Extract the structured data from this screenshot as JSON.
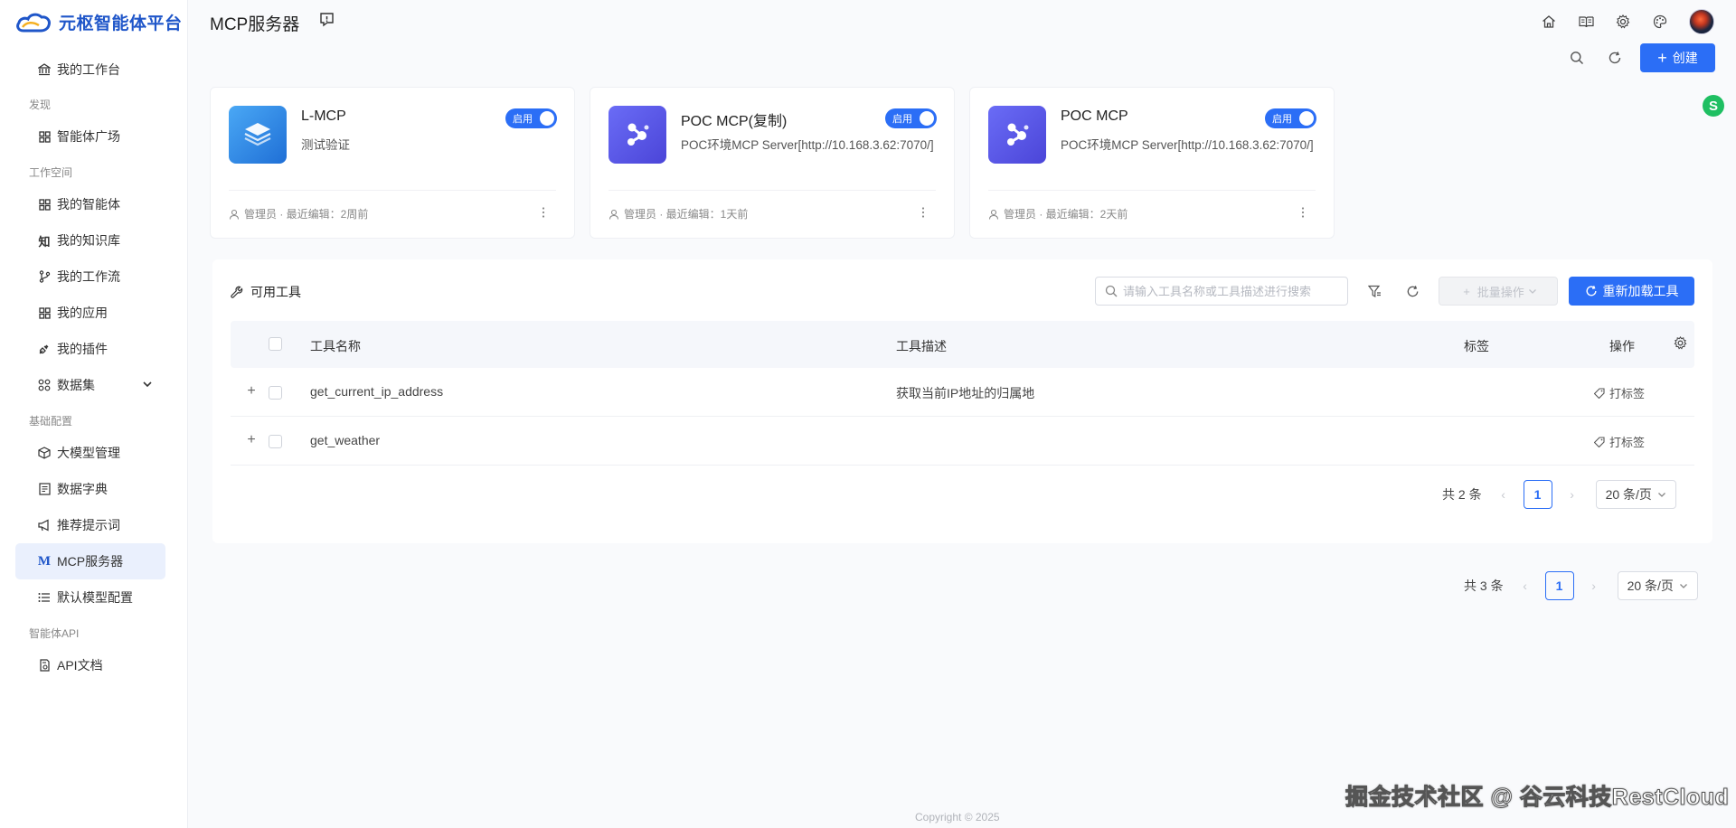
{
  "app": {
    "name": "元枢智能体平台"
  },
  "sidebar": {
    "items": [
      {
        "label": "我的工作台",
        "icon": "bank-icon"
      },
      {
        "group": "发现"
      },
      {
        "label": "智能体广场",
        "icon": "grid-icon"
      },
      {
        "group": "工作空间"
      },
      {
        "label": "我的智能体",
        "icon": "grid-icon"
      },
      {
        "label": "我的知识库",
        "icon": "knowledge-icon"
      },
      {
        "label": "我的工作流",
        "icon": "branch-icon"
      },
      {
        "label": "我的应用",
        "icon": "grid-icon"
      },
      {
        "label": "我的插件",
        "icon": "plug-icon"
      },
      {
        "label": "数据集",
        "icon": "dataset-icon"
      },
      {
        "group": "基础配置"
      },
      {
        "label": "大模型管理",
        "icon": "cube-icon"
      },
      {
        "label": "数据字典",
        "icon": "book-icon"
      },
      {
        "label": "推荐提示词",
        "icon": "megaphone-icon"
      },
      {
        "label": "MCP服务器",
        "icon": "m-icon",
        "active": true
      },
      {
        "label": "默认模型配置",
        "icon": "list-icon"
      },
      {
        "group": "智能体API"
      },
      {
        "label": "API文档",
        "icon": "doc-icon"
      }
    ]
  },
  "header": {
    "title": "MCP服务器",
    "create_label": "创建",
    "float_badge": "S"
  },
  "servers": [
    {
      "name": "L-MCP",
      "desc": "测试验证",
      "status": "启用",
      "meta": "管理员 · 最近编辑：2周前",
      "icon": "layers-icon"
    },
    {
      "name": "POC MCP(复制)",
      "desc": "POC环境MCP Server[http://10.168.3.62:7070/]",
      "status": "启用",
      "meta": "管理员 · 最近编辑：1天前",
      "icon": "molecule-icon"
    },
    {
      "name": "POC MCP",
      "desc": "POC环境MCP Server[http://10.168.3.62:7070/]",
      "status": "启用",
      "meta": "管理员 · 最近编辑：2天前",
      "icon": "molecule-icon"
    }
  ],
  "tools": {
    "title": "可用工具",
    "search_placeholder": "请输入工具名称或工具描述进行搜索",
    "batch_label": "批量操作",
    "reload_label": "重新加载工具",
    "columns": {
      "name": "工具名称",
      "desc": "工具描述",
      "tags": "标签",
      "ops": "操作"
    },
    "rows": [
      {
        "expand": "+",
        "name": "get_current_ip_address",
        "desc": "获取当前IP地址的归属地",
        "tag_action": "打标签"
      },
      {
        "expand": "+",
        "name": "get_weather",
        "desc": "",
        "tag_action": "打标签"
      }
    ],
    "pagination": {
      "total": "共 2 条",
      "page": "1",
      "size": "20 条/页"
    }
  },
  "pagination": {
    "total": "共 3 条",
    "page": "1",
    "size": "20 条/页"
  },
  "footer": {
    "watermark": "掘金技术社区 @ 谷云科技RestCloud",
    "copyright": "Copyright © 2025"
  },
  "colors": {
    "primary": "#2b6ef6",
    "brand": "#1f56c9",
    "active_bg": "#eaf0fd"
  }
}
